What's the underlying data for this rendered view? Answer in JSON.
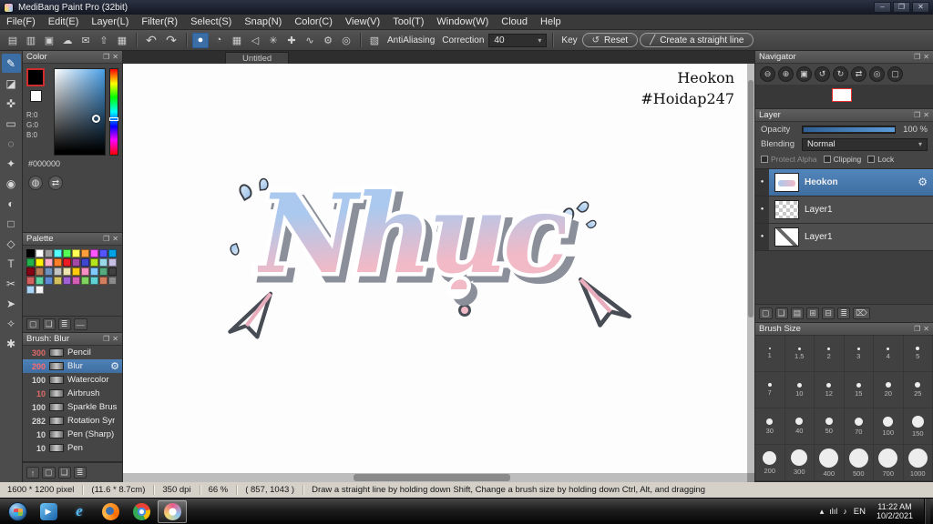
{
  "window": {
    "title": "MediBang Paint Pro (32bit)",
    "controls": [
      {
        "name": "minimize-button",
        "glyph": "–"
      },
      {
        "name": "maximize-button",
        "glyph": "❐"
      },
      {
        "name": "close-button",
        "glyph": "✕"
      }
    ]
  },
  "menu": {
    "items": [
      "File(F)",
      "Edit(E)",
      "Layer(L)",
      "Filter(R)",
      "Select(S)",
      "Snap(N)",
      "Color(C)",
      "View(V)",
      "Tool(T)",
      "Window(W)",
      "Cloud",
      "Help"
    ]
  },
  "toolbar": {
    "file_icons": [
      {
        "name": "new-canvas-icon",
        "glyph": "▤"
      },
      {
        "name": "open-icon",
        "glyph": "▥"
      },
      {
        "name": "save-icon",
        "glyph": "▣"
      },
      {
        "name": "cloud-icon",
        "glyph": "☁"
      },
      {
        "name": "comment-icon",
        "glyph": "✉"
      },
      {
        "name": "export-icon",
        "glyph": "⇧"
      },
      {
        "name": "grid-view-icon",
        "glyph": "▦"
      }
    ],
    "history_icons": [
      {
        "name": "undo-icon",
        "glyph": "↶"
      },
      {
        "name": "redo-icon",
        "glyph": "↷"
      }
    ],
    "brush_icons": [
      {
        "name": "brush-preview-icon",
        "glyph": "●",
        "active": true
      },
      {
        "name": "pen-pressure-icon",
        "glyph": "◔"
      },
      {
        "name": "grid-snap-icon",
        "glyph": "▦"
      },
      {
        "name": "pointer-icon",
        "glyph": "◁"
      },
      {
        "name": "snap-off-icon",
        "glyph": "✳"
      },
      {
        "name": "snap-cross-icon",
        "glyph": "✚"
      },
      {
        "name": "snap-curve-icon",
        "glyph": "∿"
      },
      {
        "name": "snap-settings-icon",
        "glyph": "⚙"
      },
      {
        "name": "snap-radial-icon",
        "glyph": "◎"
      }
    ],
    "antialiasing": {
      "label": "AntiAliasing"
    },
    "correction": {
      "label": "Correction",
      "value": "40"
    },
    "key_label": "Key",
    "reset": {
      "label": "Reset",
      "icon_glyph": "↺"
    },
    "straight_line": {
      "label": "Create a straight line",
      "icon_glyph": "╱"
    }
  },
  "toolstrip": {
    "tools": [
      {
        "name": "brush-tool",
        "glyph": "✎",
        "active": true
      },
      {
        "name": "eraser-tool",
        "glyph": "◪"
      },
      {
        "name": "move-tool",
        "glyph": "✜"
      },
      {
        "name": "select-tool",
        "glyph": "▭"
      },
      {
        "name": "lasso-tool",
        "glyph": "◌"
      },
      {
        "name": "magic-wand-tool",
        "glyph": "✦"
      },
      {
        "name": "bucket-tool",
        "glyph": "◉"
      },
      {
        "name": "gradient-tool",
        "glyph": "◐"
      },
      {
        "name": "shape-brush-tool",
        "glyph": "□"
      },
      {
        "name": "polygon-tool",
        "glyph": "◇"
      },
      {
        "name": "text-tool",
        "glyph": "T"
      },
      {
        "name": "divide-tool",
        "glyph": "✂"
      },
      {
        "name": "operation-tool",
        "glyph": "➤"
      },
      {
        "name": "eyedropper-tool",
        "glyph": "✧"
      },
      {
        "name": "hand-tool",
        "glyph": "✱"
      }
    ]
  },
  "color_panel": {
    "title": "Color",
    "r": "R:0",
    "g": "G:0",
    "b": "B:0",
    "hex": "#000000",
    "icons": [
      {
        "name": "color-wheel-icon",
        "glyph": "◍"
      },
      {
        "name": "swap-colors-icon",
        "glyph": "⇄"
      }
    ]
  },
  "palette_panel": {
    "title": "Palette",
    "colors": [
      "#000000",
      "#ffffff",
      "#9c9c9c",
      "#55ffff",
      "#55ff55",
      "#ffff55",
      "#ff9e3d",
      "#ff55ff",
      "#5555ff",
      "#00a2e8",
      "#22b14c",
      "#fff200",
      "#ffaec9",
      "#ff7f27",
      "#ed1c24",
      "#a349a4",
      "#3f48cc",
      "#b5e61d",
      "#99d9ea",
      "#c8bfe7",
      "#880015",
      "#b97a57",
      "#7092be",
      "#c3c3c3",
      "#efe4b0",
      "#ffc90e",
      "#f78fc2",
      "#7fc9ff",
      "#55aa7f",
      "#404040",
      "#d35f5f",
      "#5fd3a0",
      "#5f8ad3",
      "#d3c05f",
      "#a05fd3",
      "#d35fb4",
      "#7fd35f",
      "#5fd3d3",
      "#d37f5f",
      "#8a8a8a",
      "#aad4f5",
      "#f5f5f5"
    ],
    "footer_icons": [
      {
        "name": "add-color-icon",
        "glyph": "▢"
      },
      {
        "name": "duplicate-color-icon",
        "glyph": "❏"
      },
      {
        "name": "palette-menu-icon",
        "glyph": "≣"
      },
      {
        "name": "gradient-strip-icon",
        "glyph": "—"
      }
    ]
  },
  "brush_panel": {
    "title": "Brush: Blur",
    "items": [
      {
        "size": "300",
        "name": "Pencil",
        "selected": false,
        "number_color": "#e06a6a"
      },
      {
        "size": "200",
        "name": "Blur",
        "selected": true,
        "number_color": "#ff6b6b"
      },
      {
        "size": "100",
        "name": "Watercolor",
        "selected": false,
        "number_color": "#d8d8d8"
      },
      {
        "size": "10",
        "name": "Airbrush",
        "selected": false,
        "number_color": "#e06a6a"
      },
      {
        "size": "100",
        "name": "Sparkle Brus",
        "selected": false,
        "number_color": "#d8d8d8"
      },
      {
        "size": "282",
        "name": "Rotation Syr",
        "selected": false,
        "number_color": "#d8d8d8"
      },
      {
        "size": "10",
        "name": "Pen (Sharp)",
        "selected": false,
        "number_color": "#d8d8d8"
      },
      {
        "size": "10",
        "name": "Pen",
        "selected": false,
        "number_color": "#d8d8d8"
      }
    ]
  },
  "left_footer": {
    "icons": [
      {
        "name": "dock-up-icon",
        "glyph": "↑"
      },
      {
        "name": "new-brush-icon",
        "glyph": "▢"
      },
      {
        "name": "duplicate-brush-icon",
        "glyph": "❏"
      },
      {
        "name": "brush-menu-icon",
        "glyph": "≣"
      }
    ]
  },
  "canvas": {
    "tab": "Untitled",
    "watermark_line1": "Heokon",
    "watermark_line2": "#Hoidap247",
    "artwork_text": "Nhục",
    "artwork_colors": {
      "top": "#abc9ee",
      "bottom": "#f2b9c6",
      "outline": "#ffffff",
      "shadow": "#8a8f99"
    }
  },
  "navigator_panel": {
    "title": "Navigator",
    "buttons": [
      {
        "name": "zoom-out-icon",
        "glyph": "⊖"
      },
      {
        "name": "zoom-in-icon",
        "glyph": "⊕"
      },
      {
        "name": "fit-window-icon",
        "glyph": "▣"
      },
      {
        "name": "rotate-left-icon",
        "glyph": "↺"
      },
      {
        "name": "rotate-right-icon",
        "glyph": "↻"
      },
      {
        "name": "flip-icon",
        "glyph": "⇄"
      },
      {
        "name": "reset-view-icon",
        "glyph": "◎"
      },
      {
        "name": "fullscreen-icon",
        "glyph": "▢"
      }
    ]
  },
  "layer_panel": {
    "title": "Layer",
    "opacity_label": "Opacity",
    "opacity_value": "100 %",
    "blending_label": "Blending",
    "blending_value": "Normal",
    "protect_alpha_label": "Protect Alpha",
    "clipping_label": "Clipping",
    "lock_label": "Lock",
    "layers": [
      {
        "name": "Heokon",
        "selected": true,
        "thumb": "text"
      },
      {
        "name": "Layer1",
        "selected": false,
        "thumb": "checker"
      },
      {
        "name": "Layer1",
        "selected": false,
        "thumb": "marks"
      }
    ],
    "footer_icons": [
      {
        "name": "new-layer-icon",
        "glyph": "▢"
      },
      {
        "name": "duplicate-layer-icon",
        "glyph": "❏"
      },
      {
        "name": "layer-folder-icon",
        "glyph": "▤"
      },
      {
        "name": "merge-layer-icon",
        "glyph": "⊞"
      },
      {
        "name": "transfer-layer-icon",
        "glyph": "⊟"
      },
      {
        "name": "layer-menu-icon",
        "glyph": "≣"
      },
      {
        "name": "delete-layer-icon",
        "glyph": "⌦"
      }
    ]
  },
  "brush_size_panel": {
    "title": "Brush Size",
    "sizes": [
      "1",
      "1.5",
      "2",
      "3",
      "4",
      "5",
      "7",
      "10",
      "12",
      "15",
      "20",
      "25",
      "30",
      "40",
      "50",
      "70",
      "100",
      "150",
      "200",
      "300",
      "400",
      "500",
      "700",
      "1000"
    ]
  },
  "status_bar": {
    "size": "1600 * 1200 pixel",
    "dimensions": "(11.6 * 8.7cm)",
    "dpi": "350 dpi",
    "zoom": "66 %",
    "coords": "( 857, 1043 )",
    "hint": "Draw a straight line by holding down Shift, Change a brush size by holding down Ctrl, Alt, and dragging"
  },
  "taskbar": {
    "language": "EN",
    "time": "11:22 AM",
    "date": "10/2/2021",
    "icons": [
      {
        "name": "media-player",
        "kind": "wmp"
      },
      {
        "name": "internet-explorer",
        "kind": "ie"
      },
      {
        "name": "firefox",
        "kind": "ff"
      },
      {
        "name": "chrome",
        "kind": "chrome"
      },
      {
        "name": "medibang",
        "kind": "mdp",
        "active": true
      }
    ],
    "tray_icons": [
      {
        "name": "hidden-icons-icon",
        "glyph": "▴"
      },
      {
        "name": "network-icon",
        "glyph": "ılıl"
      },
      {
        "name": "volume-icon",
        "glyph": "♪"
      }
    ]
  },
  "icons": {
    "caret": "▾",
    "panel_popout": "❐",
    "panel_close": "✕",
    "gear": "⚙",
    "eye": "●",
    "antialiasing_glyph": "▧"
  }
}
